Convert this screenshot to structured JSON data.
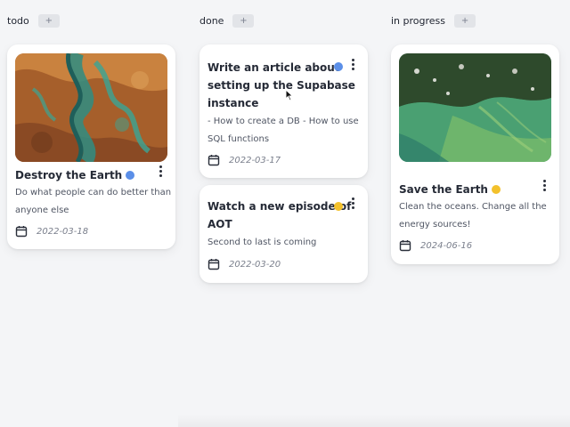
{
  "columns": [
    {
      "title": "todo",
      "add_label": "+",
      "cards": [
        {
          "title": "Destroy the Earth",
          "status_color": "#5b8fe8",
          "description_lines": [
            "Do what people can do better than",
            "anyone else"
          ],
          "date": "2022-03-18",
          "image": "satellite-river-delta"
        }
      ]
    },
    {
      "title": "done",
      "add_label": "+",
      "cards": [
        {
          "title_lines": [
            "Write an article about",
            "setting up the Supabase",
            "instance"
          ],
          "status_color": "#5b8fe8",
          "description_lines": [
            "- How to create a DB - How to use",
            "SQL functions"
          ],
          "date": "2022-03-17"
        },
        {
          "title_lines": [
            "Watch a new episode of",
            "AOT"
          ],
          "status_color": "#f3c12c",
          "description_lines": [
            "Second to last is coming"
          ],
          "date": "2022-03-20"
        }
      ]
    },
    {
      "title": "in progress",
      "add_label": "+",
      "cards": [
        {
          "title": "Save the Earth",
          "status_color": "#f3c12c",
          "description_lines": [
            "Clean the oceans. Change all the",
            "energy sources!"
          ],
          "date": "2024-06-16",
          "image": "satellite-coastline"
        }
      ]
    }
  ],
  "icons": {
    "menu": "kebab-menu-icon",
    "date": "calendar-icon",
    "cursor": "mouse-pointer-icon"
  }
}
